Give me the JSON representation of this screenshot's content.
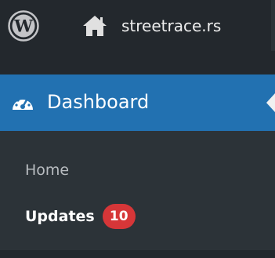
{
  "admin_bar": {
    "logo_icon": "wordpress-logo-icon",
    "home_icon": "home-icon",
    "site_name": "streetrace.rs"
  },
  "sidebar": {
    "dashboard": {
      "icon": "dashboard-gauge-icon",
      "label": "Dashboard"
    },
    "submenu": {
      "home_label": "Home",
      "updates_label": "Updates",
      "updates_count": "10"
    }
  },
  "colors": {
    "admin_bar_bg": "#23282d",
    "active_menu_bg": "#2271b1",
    "submenu_bg": "#2c3338",
    "badge_bg": "#d63638"
  }
}
